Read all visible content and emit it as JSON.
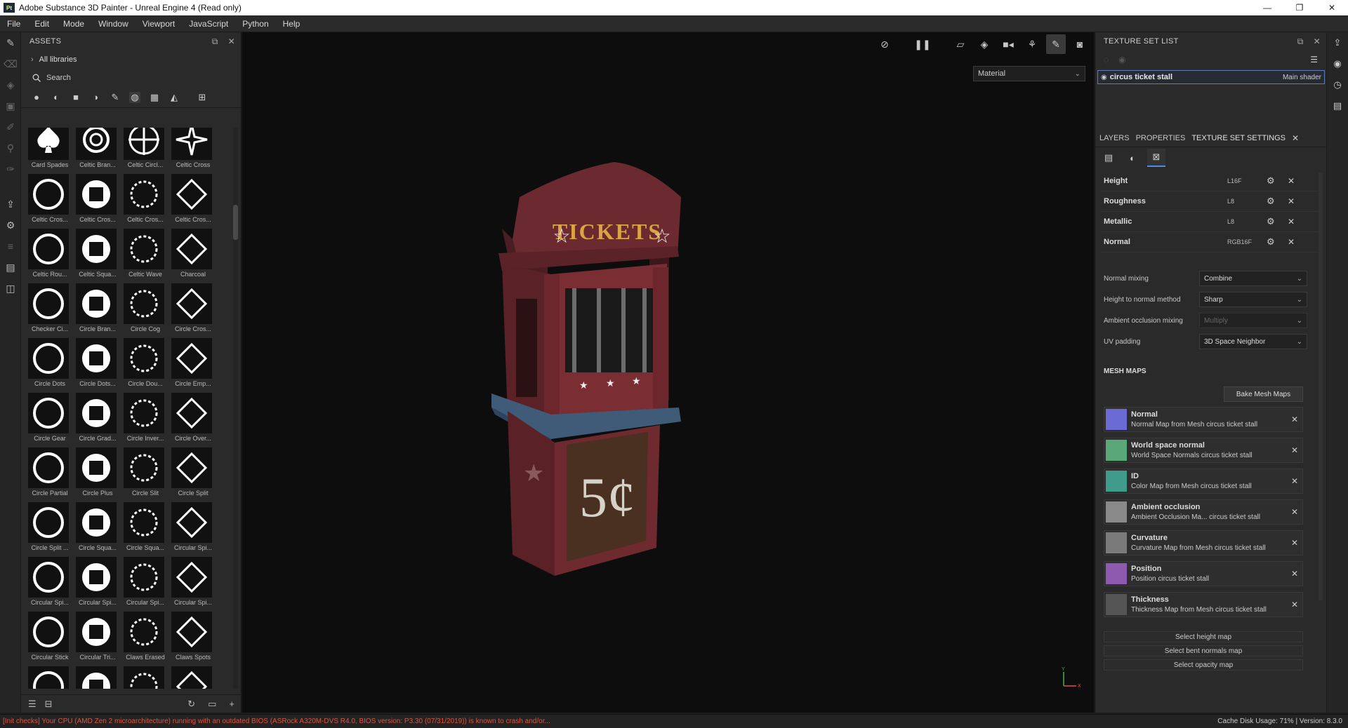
{
  "window": {
    "title": "Adobe Substance 3D Painter - Unreal Engine 4 (Read only)",
    "logo_text": "Pt",
    "controls": [
      "—",
      "❐",
      "✕"
    ]
  },
  "menu": [
    "File",
    "Edit",
    "Mode",
    "Window",
    "Viewport",
    "JavaScript",
    "Python",
    "Help"
  ],
  "assets": {
    "title": "ASSETS",
    "library": "All libraries",
    "search_placeholder": "Search",
    "items": [
      "Card Spades",
      "Celtic Bran...",
      "Celtic Circl...",
      "Celtic Cross",
      "Celtic Cros...",
      "Celtic Cros...",
      "Celtic Cros...",
      "Celtic Cros...",
      "Celtic Rou...",
      "Celtic Squa...",
      "Celtic Wave",
      "Charcoal",
      "Checker Ci...",
      "Circle Bran...",
      "Circle Cog",
      "Circle Cros...",
      "Circle Dots",
      "Circle Dots...",
      "Circle Dou...",
      "Circle Emp...",
      "Circle Gear",
      "Circle Grad...",
      "Circle Inver...",
      "Circle Over...",
      "Circle Partial",
      "Circle Plus",
      "Circle Slit",
      "Circle Split",
      "Circle Split ...",
      "Circle Squa...",
      "Circle Squa...",
      "Circular Spi...",
      "Circular Spi...",
      "Circular Spi...",
      "Circular Spi...",
      "Circular Spi...",
      "Circular Stick",
      "Circular Tri...",
      "Claws Erased",
      "Claws Spots",
      "",
      "",
      "",
      ""
    ]
  },
  "viewport": {
    "mode_select": "Material",
    "model": {
      "sign_text": "TICKETS",
      "price_text": "5¢"
    },
    "axis_labels": {
      "y": "Y",
      "x": "X"
    }
  },
  "texture_set_list": {
    "title": "TEXTURE SET LIST",
    "set_name": "circus ticket stall",
    "shader": "Main shader"
  },
  "tabs": [
    "LAYERS",
    "PROPERTIES",
    "TEXTURE SET SETTINGS"
  ],
  "channels": [
    {
      "name": "Height",
      "format": "L16F"
    },
    {
      "name": "Roughness",
      "format": "L8"
    },
    {
      "name": "Metallic",
      "format": "L8"
    },
    {
      "name": "Normal",
      "format": "RGB16F"
    }
  ],
  "settings": [
    {
      "label": "Normal mixing",
      "value": "Combine",
      "disabled": false
    },
    {
      "label": "Height to normal method",
      "value": "Sharp",
      "disabled": false
    },
    {
      "label": "Ambient occlusion mixing",
      "value": "Multiply",
      "disabled": true
    },
    {
      "label": "UV padding",
      "value": "3D Space Neighbor",
      "disabled": false
    }
  ],
  "mesh_maps": {
    "title": "MESH MAPS",
    "bake_button": "Bake Mesh Maps",
    "maps": [
      {
        "name": "Normal",
        "desc": "Normal Map from Mesh circus ticket stall",
        "color": "#6b6bd6"
      },
      {
        "name": "World space normal",
        "desc": "World Space Normals circus ticket stall",
        "color": "#5aa87a"
      },
      {
        "name": "ID",
        "desc": "Color Map from Mesh circus ticket stall",
        "color": "#3f9b8a"
      },
      {
        "name": "Ambient occlusion",
        "desc": "Ambient Occlusion Ma... circus ticket stall",
        "color": "#8a8a8a"
      },
      {
        "name": "Curvature",
        "desc": "Curvature Map from Mesh circus ticket stall",
        "color": "#7a7a7a"
      },
      {
        "name": "Position",
        "desc": "Position circus ticket stall",
        "color": "#8d5ab0"
      },
      {
        "name": "Thickness",
        "desc": "Thickness Map from Mesh circus ticket stall",
        "color": "#555555"
      }
    ],
    "select_buttons": [
      "Select height map",
      "Select bent normals map",
      "Select opacity map"
    ]
  },
  "status": {
    "warning": "[Init checks] Your CPU (AMD Zen 2 microarchitecture) running with an outdated BIOS (ASRock A320M-DVS R4.0, BIOS version: P3.30 (07/31/2019)) is known to crash and/or...",
    "right": "Cache Disk Usage:   71% | Version: 8.3.0"
  },
  "colors": {
    "accent": "#4a90e2",
    "warning": "#e0553e",
    "stall_red": "#7a2e33",
    "counter_blue": "#3f5b78",
    "sign_gold": "#d9a441"
  }
}
